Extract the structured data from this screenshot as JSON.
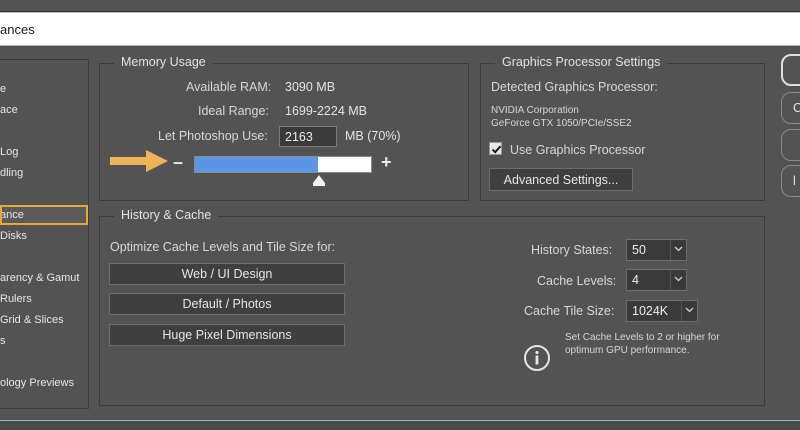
{
  "window": {
    "title": "ances"
  },
  "sidebar": {
    "items": [
      {
        "label": "e"
      },
      {
        "label": "ace"
      },
      {
        "label": "Log"
      },
      {
        "label": "dling"
      },
      {
        "label": "ance"
      },
      {
        "label": "Disks"
      },
      {
        "label": "arency & Gamut"
      },
      {
        "label": "Rulers"
      },
      {
        "label": "Grid & Slices"
      },
      {
        "label": "s"
      },
      {
        "label": "ology Previews"
      }
    ],
    "active_index": 4
  },
  "memory": {
    "title": "Memory Usage",
    "available_label": "Available RAM:",
    "available_value": "3090 MB",
    "ideal_label": "Ideal Range:",
    "ideal_value": "1699-2224 MB",
    "let_label": "Let Photoshop Use:",
    "let_value": "2163",
    "let_unit": "MB (70%)",
    "minus": "–",
    "plus": "+",
    "slider_fraction": 0.7
  },
  "gpu": {
    "title": "Graphics Processor Settings",
    "detected_label": "Detected Graphics Processor:",
    "vendor": "NVIDIA Corporation",
    "model": "GeForce GTX 1050/PCIe/SSE2",
    "use_label": "Use Graphics Processor",
    "use_checked": true,
    "advanced_button": "Advanced Settings..."
  },
  "history": {
    "title": "History & Cache",
    "optimize_label": "Optimize Cache Levels and Tile Size for:",
    "buttons": [
      "Web / UI Design",
      "Default / Photos",
      "Huge Pixel Dimensions"
    ],
    "history_states_label": "History States:",
    "history_states_value": "50",
    "cache_levels_label": "Cache Levels:",
    "cache_levels_value": "4",
    "cache_tile_label": "Cache Tile Size:",
    "cache_tile_value": "1024K",
    "note_line1": "Set Cache Levels to 2 or higher for",
    "note_line2": "optimum GPU performance."
  },
  "right_buttons": [
    {
      "label": ""
    },
    {
      "label": "C"
    },
    {
      "label": ""
    },
    {
      "label": "l"
    }
  ],
  "colors": {
    "accent_highlight": "#e8a73c",
    "slider_fill": "#5b95e6",
    "panel_bg": "#535353",
    "arrow": "#f0b35a"
  }
}
